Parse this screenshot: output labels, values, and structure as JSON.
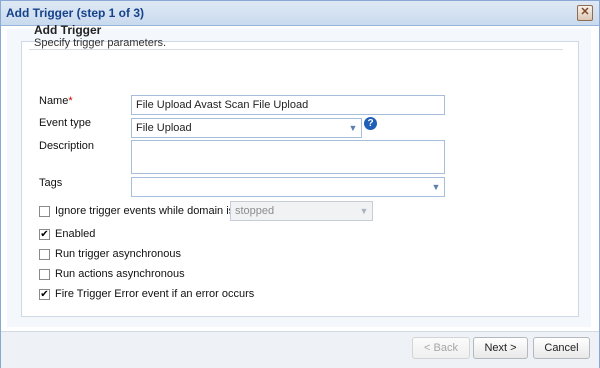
{
  "window": {
    "title": "Add Trigger (step 1 of 3)",
    "close_glyph": "✕"
  },
  "section": {
    "title": "Add Trigger",
    "subtitle": "Specify trigger parameters."
  },
  "form": {
    "name_label": "Name",
    "name_required": "*",
    "name_value": "File Upload Avast Scan File Upload",
    "event_type_label": "Event type",
    "event_type_value": "File Upload",
    "help_glyph": "?",
    "description_label": "Description",
    "description_value": "",
    "tags_label": "Tags",
    "tags_value": ""
  },
  "options": {
    "ignore_label": "Ignore trigger events while domain is",
    "ignore_checked": false,
    "ignore_select_value": "stopped",
    "enabled_label": "Enabled",
    "enabled_checked": true,
    "async_trigger_label": "Run trigger asynchronous",
    "async_trigger_checked": false,
    "async_actions_label": "Run actions asynchronous",
    "async_actions_checked": false,
    "fire_error_label": "Fire Trigger Error event if an error occurs",
    "fire_error_checked": true
  },
  "footer": {
    "back_label": "< Back",
    "next_label": "Next >",
    "cancel_label": "Cancel"
  },
  "colors": {
    "title_text": "#15428b",
    "help_icon": "#1f5fb8",
    "border": "#a6bedc"
  }
}
